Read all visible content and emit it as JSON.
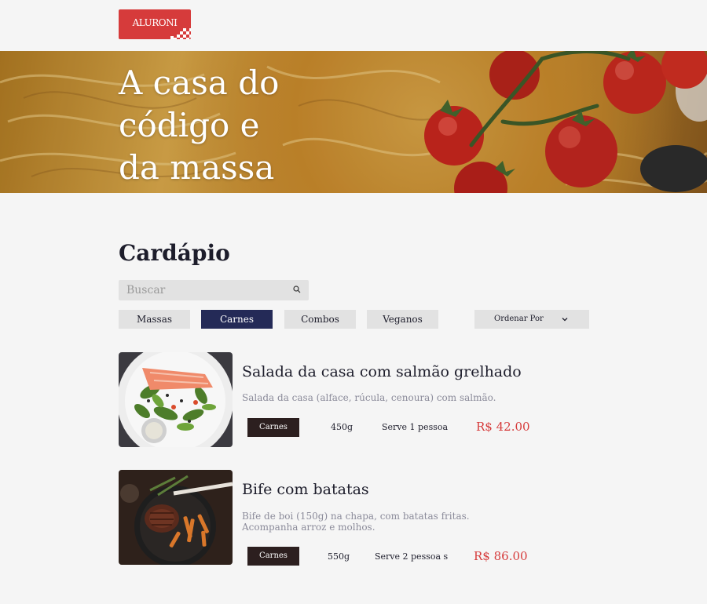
{
  "header": {
    "logo_text": "ALURONI",
    "brand_color": "#d63b3b"
  },
  "hero": {
    "line1": "A casa do",
    "line2": "código e",
    "line3": "da massa"
  },
  "menu": {
    "title": "Cardápio",
    "search": {
      "placeholder": "Buscar",
      "value": ""
    },
    "filters": [
      {
        "label": "Massas",
        "active": false
      },
      {
        "label": "Carnes",
        "active": true
      },
      {
        "label": "Combos",
        "active": false
      },
      {
        "label": "Veganos",
        "active": false
      }
    ],
    "sort_label": "Ordenar Por",
    "active_color": "#242a57"
  },
  "items": [
    {
      "title": "Salada da casa com salmão grelhado",
      "description": "Salada da casa (alface, rúcula, cenoura) com salmão.",
      "category": "Carnes",
      "weight": "450g",
      "serves": "Serve 1 pessoa",
      "price": "R$ 42.00",
      "image": "salmon-salad-photo"
    },
    {
      "title": "Bife com batatas",
      "description": "Bife de boi (150g) na chapa, com batatas fritas. Acompanha arroz e molhos.",
      "category": "Carnes",
      "weight": "550g",
      "serves": "Serve 2 pessoa s",
      "price": "R$ 86.00",
      "image": "steak-fries-photo"
    }
  ]
}
